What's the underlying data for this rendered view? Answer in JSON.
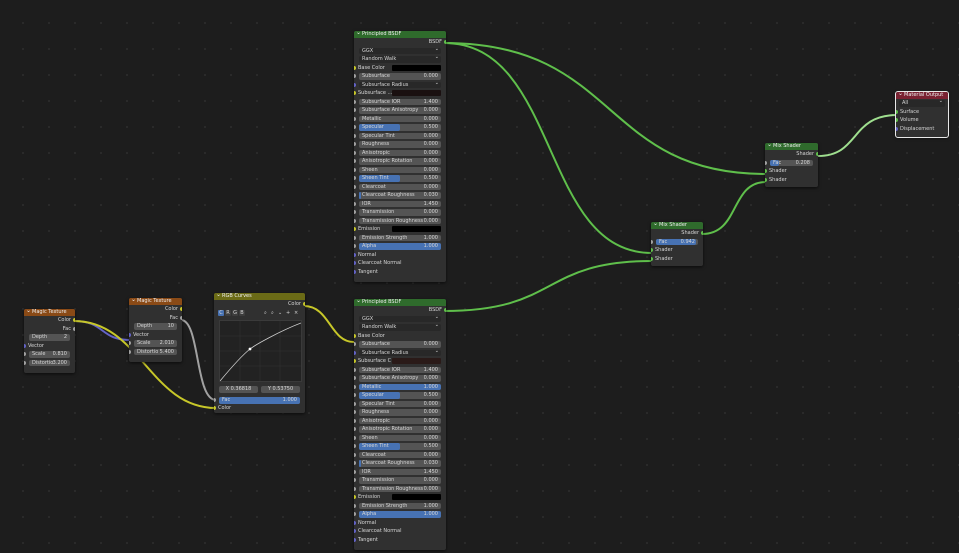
{
  "nodes": {
    "magic1": {
      "title": "Magic Texture",
      "out_color": "Color",
      "out_fac": "Fac",
      "depth_label": "Depth",
      "depth_value": "2",
      "vector": "Vector",
      "scale_label": "Scale",
      "scale_value": "0.810",
      "distortion_label": "Distortio",
      "distortion_value": "3.200"
    },
    "magic2": {
      "title": "Magic Texture",
      "out_color": "Color",
      "out_fac": "Fac",
      "depth_label": "Depth",
      "depth_value": "10",
      "vector": "Vector",
      "scale_label": "Scale",
      "scale_value": "2.010",
      "distortion_label": "Distortio",
      "distortion_value": "5.400"
    },
    "curves": {
      "title": "RGB Curves",
      "out_color": "Color",
      "tabs": [
        "C",
        "R",
        "G",
        "B"
      ],
      "x_readout": "X 0.36818",
      "y_readout": "Y 0.53750",
      "fac_label": "Fac",
      "fac_value": "1.000",
      "fac_fraction": 1.0,
      "color_in": "Color"
    },
    "bsdf1": {
      "title": "Principled BSDF",
      "out": "BSDF",
      "distribution": "GGX",
      "subsurface_method": "Random Walk",
      "base_color_label": "Base Color",
      "base_color_hex": "#000000",
      "rows": [
        {
          "label": "Subsurface",
          "value": "0.000",
          "fill": 0.0
        },
        {
          "label": "Subsurface Radius",
          "dropdown": true
        },
        {
          "label": "Subsurface ...",
          "swatch": "#1a1010"
        },
        {
          "label": "Subsurface IOR",
          "value": "1.400",
          "fill": 0.0
        },
        {
          "label": "Subsurface Anisotropy",
          "value": "0.000",
          "fill": 0.0
        },
        {
          "label": "Metallic",
          "value": "0.000",
          "fill": 0.0
        },
        {
          "label": "Specular",
          "value": "0.500",
          "fill": 0.5
        },
        {
          "label": "Specular Tint",
          "value": "0.000",
          "fill": 0.0
        },
        {
          "label": "Roughness",
          "value": "0.000",
          "fill": 0.0
        },
        {
          "label": "Anisotropic",
          "value": "0.000",
          "fill": 0.0
        },
        {
          "label": "Anisotropic Rotation",
          "value": "0.000",
          "fill": 0.0
        },
        {
          "label": "Sheen",
          "value": "0.000",
          "fill": 0.0
        },
        {
          "label": "Sheen Tint",
          "value": "0.500",
          "fill": 0.5
        },
        {
          "label": "Clearcoat",
          "value": "0.000",
          "fill": 0.0
        },
        {
          "label": "Clearcoat Roughness",
          "value": "0.030",
          "fill": 0.03
        },
        {
          "label": "IOR",
          "value": "1.450",
          "fill": 0.0
        },
        {
          "label": "Transmission",
          "value": "0.000",
          "fill": 0.0
        },
        {
          "label": "Transmission Roughness",
          "value": "0.000",
          "fill": 0.0
        },
        {
          "label": "Emission",
          "swatch": "#000000"
        },
        {
          "label": "Emission Strength",
          "value": "1.000",
          "fill": 0.0
        },
        {
          "label": "Alpha",
          "value": "1.000",
          "fill": 1.0
        },
        {
          "label": "Normal",
          "plain": true
        },
        {
          "label": "Clearcoat Normal",
          "plain": true
        },
        {
          "label": "Tangent",
          "plain": true
        }
      ]
    },
    "bsdf2": {
      "title": "Principled BSDF",
      "out": "BSDF",
      "distribution": "GGX",
      "subsurface_method": "Random Walk",
      "base_color_label": "Base Color",
      "rows": [
        {
          "label": "Subsurface",
          "value": "0.000",
          "fill": 0.0
        },
        {
          "label": "Subsurface Radius",
          "dropdown": true
        },
        {
          "label": "Subsurface C",
          "swatch": "#2a1a18"
        },
        {
          "label": "Subsurface IOR",
          "value": "1.400",
          "fill": 0.0
        },
        {
          "label": "Subsurface Anisotropy",
          "value": "0.000",
          "fill": 0.0
        },
        {
          "label": "Metallic",
          "value": "1.000",
          "fill": 1.0
        },
        {
          "label": "Specular",
          "value": "0.500",
          "fill": 0.5
        },
        {
          "label": "Specular Tint",
          "value": "0.000",
          "fill": 0.0
        },
        {
          "label": "Roughness",
          "value": "0.000",
          "fill": 0.0
        },
        {
          "label": "Anisotropic",
          "value": "0.000",
          "fill": 0.0
        },
        {
          "label": "Anisotropic Rotation",
          "value": "0.000",
          "fill": 0.0
        },
        {
          "label": "Sheen",
          "value": "0.000",
          "fill": 0.0
        },
        {
          "label": "Sheen Tint",
          "value": "0.500",
          "fill": 0.5
        },
        {
          "label": "Clearcoat",
          "value": "0.000",
          "fill": 0.0
        },
        {
          "label": "Clearcoat Roughness",
          "value": "0.030",
          "fill": 0.03
        },
        {
          "label": "IOR",
          "value": "1.450",
          "fill": 0.0
        },
        {
          "label": "Transmission",
          "value": "0.000",
          "fill": 0.0
        },
        {
          "label": "Transmission Roughness",
          "value": "0.000",
          "fill": 0.0
        },
        {
          "label": "Emission",
          "swatch": "#000000"
        },
        {
          "label": "Emission Strength",
          "value": "1.000",
          "fill": 0.0
        },
        {
          "label": "Alpha",
          "value": "1.000",
          "fill": 1.0
        },
        {
          "label": "Normal",
          "plain": true
        },
        {
          "label": "Clearcoat Normal",
          "plain": true
        },
        {
          "label": "Tangent",
          "plain": true
        }
      ]
    },
    "mix1": {
      "title": "Mix Shader",
      "out": "Shader",
      "fac_label": "Fac",
      "fac_value": "0.942",
      "fac_fraction": 0.942,
      "in1": "Shader",
      "in2": "Shader"
    },
    "mix2": {
      "title": "Mix Shader",
      "out": "Shader",
      "fac_label": "Fac",
      "fac_value": "0.208",
      "fac_fraction": 0.208,
      "in1": "Shader",
      "in2": "Shader"
    },
    "output": {
      "title": "Material Output",
      "target": "All",
      "surface": "Surface",
      "volume": "Volume",
      "displacement": "Displacement"
    }
  },
  "colors": {
    "shader_link": "#5fbf4b",
    "color_link": "#c7c729",
    "vector_link": "#6363c7",
    "accent": "#4772b3"
  }
}
